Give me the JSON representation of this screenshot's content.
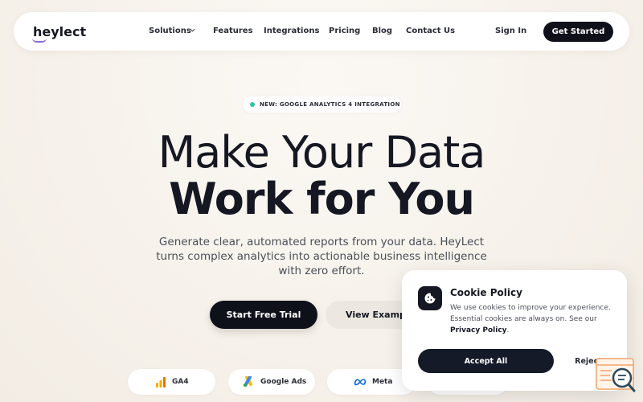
{
  "nav": {
    "logo": "heylect",
    "links": [
      "Solutions",
      "Features",
      "Integrations",
      "Pricing",
      "Blog",
      "Contact Us"
    ],
    "sign_in": "Sign In",
    "get_started": "Get Started"
  },
  "badge": {
    "text": "NEW: GOOGLE ANALYTICS 4 INTEGRATION",
    "dot_color": "#34c3a0"
  },
  "hero": {
    "title_line1": "Make Your Data",
    "title_line2": "Work for You",
    "subtitle": "Generate clear, automated reports from your data. HeyLect turns complex analytics into actionable business intelligence with zero effort.",
    "primary_cta": "Start Free Trial",
    "secondary_cta": "View Examples"
  },
  "integrations": [
    {
      "label": "GA4",
      "icon": "bar-chart-icon"
    },
    {
      "label": "Google Ads",
      "icon": "google-ads-icon"
    },
    {
      "label": "Meta",
      "icon": "meta-icon"
    }
  ],
  "cookie": {
    "title": "Cookie Policy",
    "text_before": "We use cookies to improve your experience. Essential cookies are always on. See our",
    "link": "Privacy Policy",
    "text_after": ".",
    "accept": "Accept All",
    "reject": "Reject"
  },
  "colors": {
    "primary": "#0f111a",
    "background": "#f7f3ee",
    "accent_green": "#34c3a0",
    "logo_underline": "#8e6ad8"
  }
}
